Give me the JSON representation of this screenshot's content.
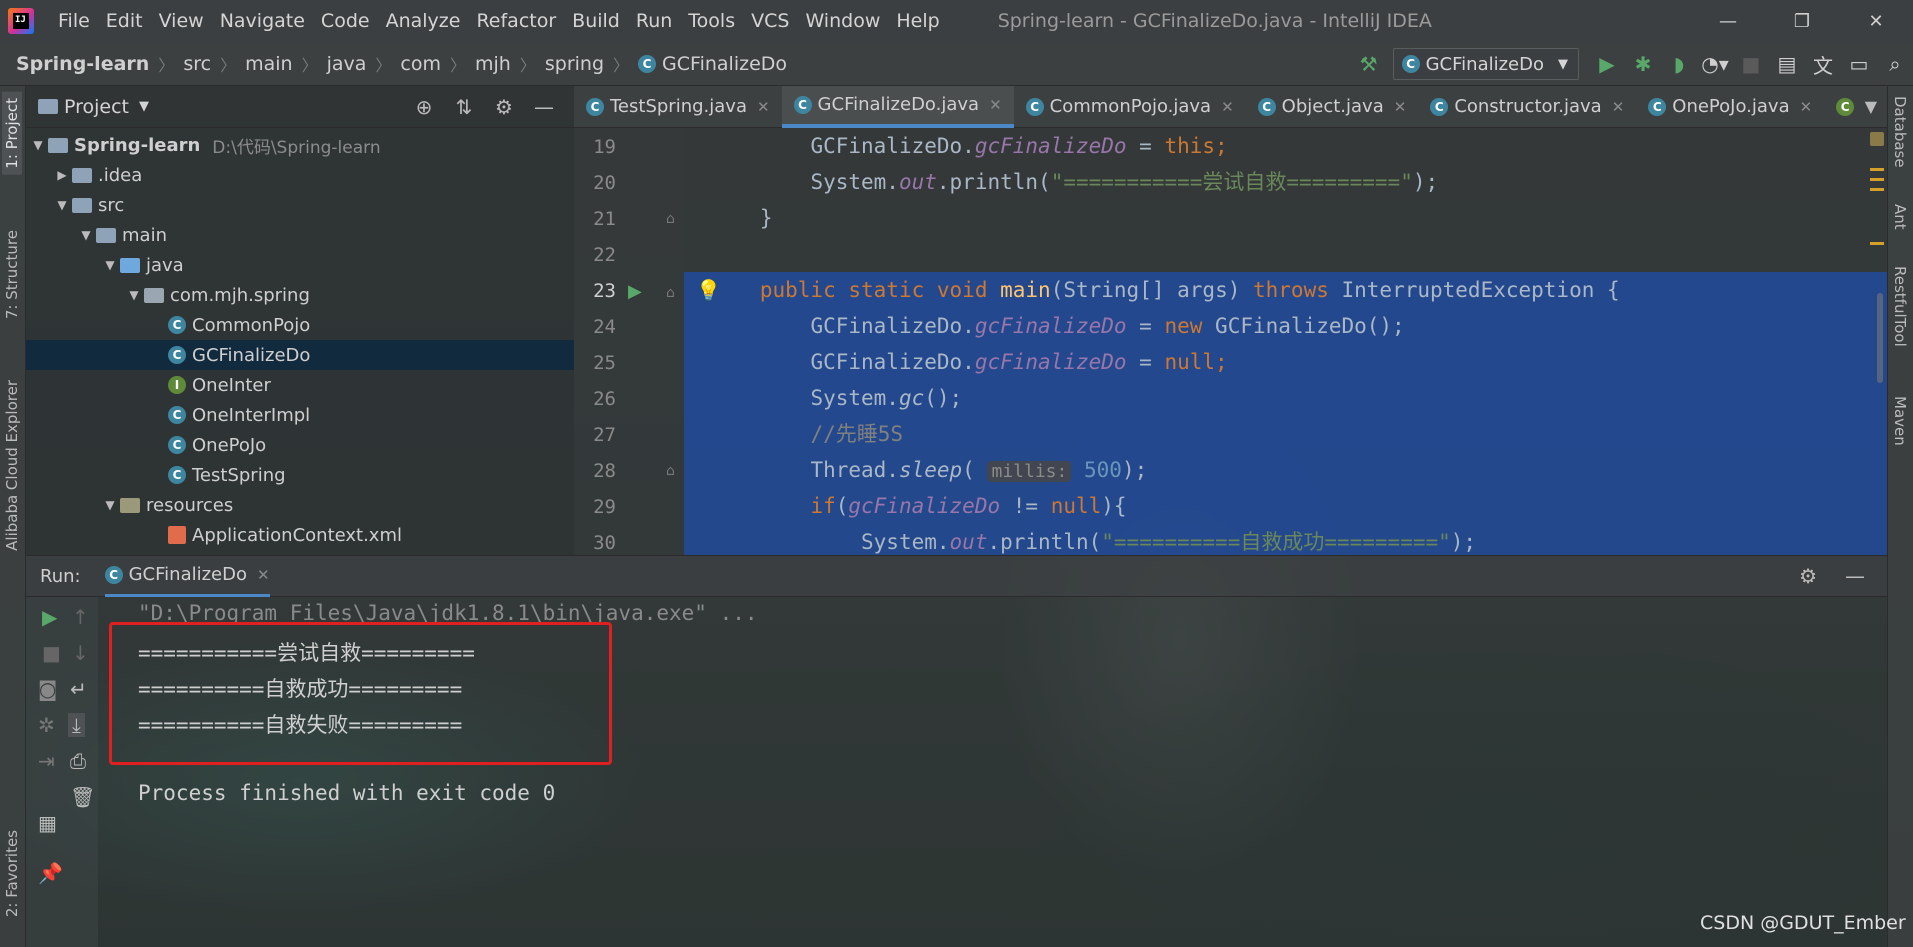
{
  "window": {
    "title": "Spring-learn - GCFinalizeDo.java - IntelliJ IDEA",
    "logo_text": "IJ",
    "controls": [
      "—",
      "❐",
      "✕"
    ]
  },
  "menu": [
    "File",
    "Edit",
    "View",
    "Navigate",
    "Code",
    "Analyze",
    "Refactor",
    "Build",
    "Run",
    "Tools",
    "VCS",
    "Window",
    "Help"
  ],
  "breadcrumb": [
    "Spring-learn",
    "src",
    "main",
    "java",
    "com",
    "mjh",
    "spring",
    "GCFinalizeDo"
  ],
  "run_config": {
    "label": "GCFinalizeDo"
  },
  "left_stripe": {
    "project": "1: Project",
    "structure": "7: Structure",
    "alibaba": "Alibaba Cloud Explorer",
    "favorites": "2: Favorites"
  },
  "right_stripe": {
    "database": "Database",
    "ant": "Ant",
    "restful": "RestfulTool",
    "maven": "Maven"
  },
  "project_panel": {
    "title": "Project",
    "tree": [
      {
        "label": "Spring-learn",
        "path": "D:\\代码\\Spring-learn"
      },
      {
        "label": ".idea"
      },
      {
        "label": "src"
      },
      {
        "label": "main"
      },
      {
        "label": "java"
      },
      {
        "label": "com.mjh.spring"
      },
      {
        "label": "CommonPojo"
      },
      {
        "label": "GCFinalizeDo"
      },
      {
        "label": "OneInter"
      },
      {
        "label": "OneInterImpl"
      },
      {
        "label": "OnePoJo"
      },
      {
        "label": "TestSpring"
      },
      {
        "label": "resources"
      },
      {
        "label": "ApplicationContext.xml"
      }
    ]
  },
  "editor_tabs": [
    "TestSpring.java",
    "GCFinalizeDo.java",
    "CommonPojo.java",
    "Object.java",
    "Constructor.java",
    "OnePoJo.java"
  ],
  "editor": {
    "line_numbers": [
      "19",
      "20",
      "21",
      "22",
      "23",
      "24",
      "25",
      "26",
      "27",
      "28",
      "29",
      "30"
    ],
    "tokens": {
      "cls": "GCFinalizeDo",
      "dot": ".",
      "field": "gcFinalizeDo",
      "assign": " = ",
      "this": "this",
      "semi": ";",
      "system": "System.",
      "out": "out",
      "println_open": ".println(",
      "str_try": "\"===========尝试自救=========\"",
      "close_paren_semi": ");",
      "brace_close": "}",
      "public": "public",
      "static": "static",
      "void": "void",
      "main": "main",
      "main_args": "(String[] args) ",
      "throws": "throws",
      "exception": " InterruptedException {",
      "new": "new",
      "ctor": " GCFinalizeDo();",
      "null": "null",
      "gc": "gc",
      "gc_call": "();",
      "comment": "//先睡5S",
      "thread": "Thread.",
      "sleep": "sleep",
      "paren_open": "(",
      "hint": "millis:",
      "num": "500",
      "if": "if",
      "neq": " != ",
      "if_tail": "){",
      "str_ok": "\"==========自救成功=========\""
    }
  },
  "run_panel": {
    "label": "Run:",
    "tab": "GCFinalizeDo",
    "console": [
      "\"D:\\Program Files\\Java\\jdk1.8.1\\bin\\java.exe\" ...",
      "===========尝试自救=========",
      "==========自救成功=========",
      "==========自救失败=========",
      "",
      "Process finished with exit code 0"
    ]
  },
  "watermark": "CSDN @GDUT_Ember"
}
